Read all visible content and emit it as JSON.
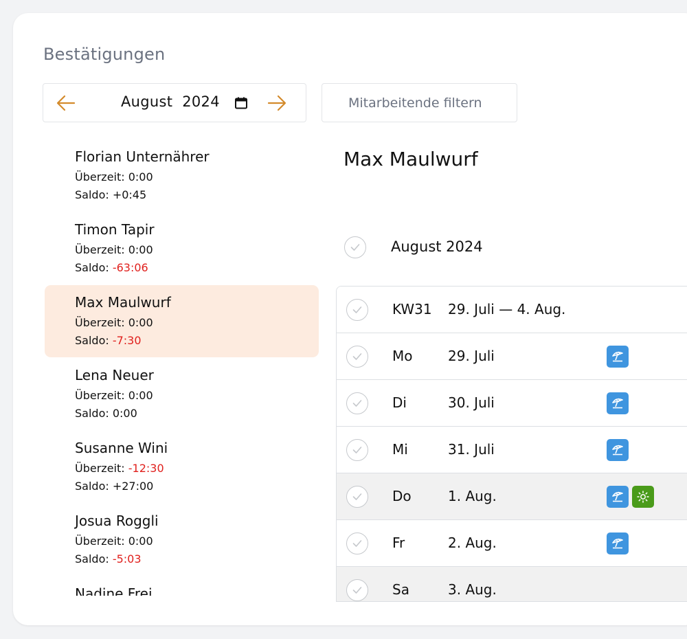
{
  "page": {
    "title": "Bestätigungen"
  },
  "month_nav": {
    "value": "August  2024",
    "prev_icon": "arrow-left-icon",
    "next_icon": "arrow-right-icon",
    "calendar_icon": "calendar-icon"
  },
  "filter": {
    "placeholder": "Mitarbeitende filtern"
  },
  "employees": [
    {
      "name": "Florian Unternährer",
      "overtime_label": "Überzeit: ",
      "overtime": "0:00",
      "saldo_label": "Saldo: ",
      "saldo": "+0:45"
    },
    {
      "name": "Timon Tapir",
      "overtime_label": "Überzeit: ",
      "overtime": "0:00",
      "saldo_label": "Saldo: ",
      "saldo": "-63:06"
    },
    {
      "name": "Max Maulwurf",
      "overtime_label": "Überzeit: ",
      "overtime": "0:00",
      "saldo_label": "Saldo: ",
      "saldo": "-7:30"
    },
    {
      "name": "Lena Neuer",
      "overtime_label": "Überzeit: ",
      "overtime": "0:00",
      "saldo_label": "Saldo: ",
      "saldo": "0:00"
    },
    {
      "name": "Susanne Wini",
      "overtime_label": "Überzeit: ",
      "overtime": "-12:30",
      "saldo_label": "Saldo: ",
      "saldo": "+27:00"
    },
    {
      "name": "Josua Roggli",
      "overtime_label": "Überzeit: ",
      "overtime": "0:00",
      "saldo_label": "Saldo: ",
      "saldo": "-5:03"
    },
    {
      "name": "Nadine Frei",
      "overtime_label": "",
      "overtime": "",
      "saldo_label": "",
      "saldo": ""
    }
  ],
  "detail": {
    "name": "Max Maulwurf",
    "month_label": "August 2024",
    "rows": [
      {
        "c1": "KW31",
        "c2": "29. Juli — 4. Aug.",
        "badges": []
      },
      {
        "c1": "Mo",
        "c2": "29. Juli",
        "badges": [
          "vacation"
        ]
      },
      {
        "c1": "Di",
        "c2": "30. Juli",
        "badges": [
          "vacation"
        ]
      },
      {
        "c1": "Mi",
        "c2": "31. Juli",
        "badges": [
          "vacation"
        ]
      },
      {
        "c1": "Do",
        "c2": "1. Aug.",
        "badges": [
          "vacation",
          "sun"
        ]
      },
      {
        "c1": "Fr",
        "c2": "2. Aug.",
        "badges": [
          "vacation"
        ]
      },
      {
        "c1": "Sa",
        "c2": "3. Aug.",
        "badges": []
      }
    ]
  },
  "colors": {
    "accent_arrow": "#d38a2b",
    "selected_bg": "#fdebdf",
    "negative": "#e0201d",
    "vacation_badge": "#3f95df",
    "sun_badge": "#4a9b1a"
  },
  "icons": {
    "check": "check-circle-icon",
    "vacation": "beach-umbrella-icon",
    "sun": "sun-icon"
  }
}
